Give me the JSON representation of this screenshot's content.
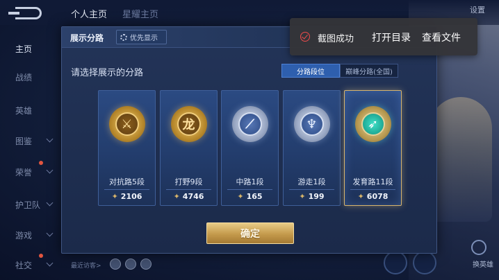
{
  "top_tabs": [
    "个人主页",
    "星耀主页"
  ],
  "top_right": "设置",
  "sidebar": {
    "items": [
      {
        "label": "主页",
        "active": true
      },
      {
        "label": "战绩"
      },
      {
        "label": "英雄"
      },
      {
        "label": "图鉴"
      },
      {
        "label": "荣誉"
      },
      {
        "label": "护卫队"
      },
      {
        "label": "游戏"
      },
      {
        "label": "社交"
      }
    ]
  },
  "recent_visits": "最近访客>",
  "hero_swap": "换英雄",
  "modal": {
    "title": "展示分路",
    "priority_button": "优先显示",
    "prompt": "请选择展示的分路",
    "segments": [
      "分路段位",
      "巅峰分路(全国)"
    ],
    "active_segment": 0,
    "cards": [
      {
        "label": "对抗路5段",
        "score": "2106",
        "medal": "gold",
        "glyph": "⚔",
        "selected": false
      },
      {
        "label": "打野9段",
        "score": "4746",
        "medal": "gold",
        "glyph": "龙",
        "selected": false
      },
      {
        "label": "中路1段",
        "score": "165",
        "medal": "silver",
        "glyph": "⟋",
        "selected": false
      },
      {
        "label": "游走1段",
        "score": "199",
        "medal": "silver",
        "glyph": "♆",
        "selected": false
      },
      {
        "label": "发育路11段",
        "score": "6078",
        "medal": "jade",
        "glyph": "➶",
        "selected": true
      }
    ],
    "confirm": "确定"
  },
  "toast": {
    "message": "截图成功",
    "open_folder": "打开目录",
    "view_file": "查看文件"
  },
  "colors": {
    "accent_gold": "#d9b56c",
    "active_segment": "#2e5fae",
    "toast_icon": "#ef4b4b"
  }
}
